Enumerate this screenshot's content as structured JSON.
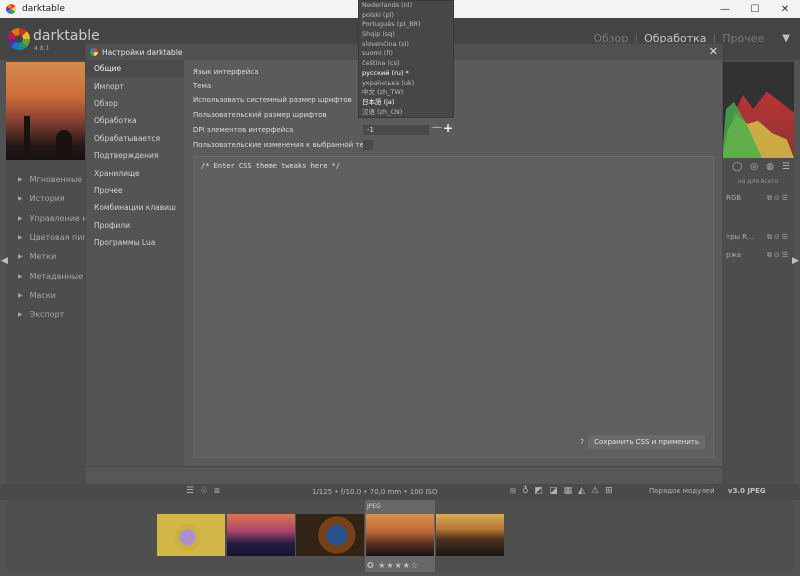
{
  "window": {
    "title": "darktable",
    "min": "—",
    "max": "☐",
    "close": "✕"
  },
  "header": {
    "brand": "darktable",
    "version": "4.8.1",
    "views": [
      "Обзор",
      "Обработка",
      "Прочее"
    ],
    "active_view": "Обработка",
    "menu_glyph": "▼"
  },
  "left_panel": {
    "modules": [
      "Мгновенные с",
      "История",
      "Управление ко",
      "Цветовая пипе",
      "Метки",
      "Метаданные",
      "Маски",
      "Экспорт"
    ]
  },
  "right_panel": {
    "sub_label": "на для всего",
    "rows": [
      {
        "label": "RGB",
        "top": 0
      },
      {
        "label": "тры R...",
        "top": 0
      },
      {
        "label": "ржа",
        "top": 0
      }
    ]
  },
  "bottombar": {
    "exif": "1/125 • f/10.0 • 70,0 mm • 100 ISO",
    "module_order_label": "Порядок модулей",
    "module_order_value": "v3.0 JPEG"
  },
  "filmstrip": {
    "selected_label": "JPEG",
    "selected_rating": "✪ ★★★★☆"
  },
  "dialog": {
    "title": "Настройки darktable",
    "close": "✕",
    "nav": [
      "Общие",
      "Импорт",
      "Обзор",
      "Обработка",
      "Обрабатывается",
      "Подтверждения",
      "Хранилище",
      "Прочее",
      "Комбинации клавиш",
      "Профили",
      "Программы Lua"
    ],
    "active_nav": "Общие",
    "settings": {
      "language": "Язык интерфейса",
      "theme": "Тема",
      "system_font": "Использовать системный размер шрифтов",
      "custom_font": "Пользовательский размер шрифтов",
      "dpi": "DPI элементов интерфейса",
      "theme_tweaks": "Пользовательские изменения к выбранной теме"
    },
    "dpi_value": "-1",
    "dpi_minus": "—",
    "dpi_plus": "+",
    "css_text": "/* Enter CSS theme tweaks here */",
    "css_help": "?",
    "css_save": "Сохранить CSS и применить"
  },
  "language_popup": {
    "options": [
      "Nederlands (nl)",
      "polski (pl)",
      "Português (pt_BR)",
      "Shqip (sq)",
      "slovenčina (sl)",
      "suomi (fi)",
      "čeština (cs)",
      "русский (ru) *",
      "українська (uk)",
      "中文 (zh_TW)",
      "日本語 (ja)",
      "汉语 (zh_CN)"
    ],
    "selected": "русский (ru) *"
  }
}
